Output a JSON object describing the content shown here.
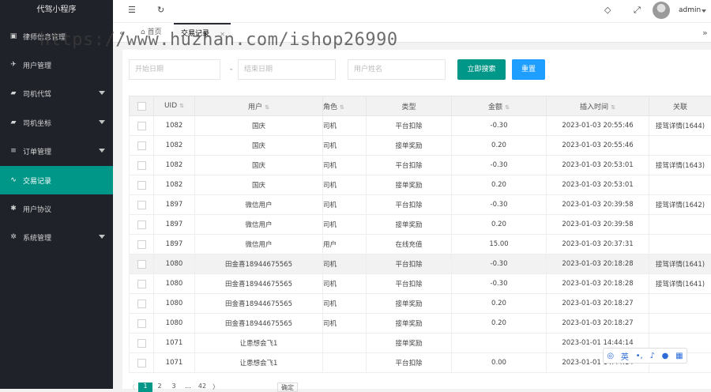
{
  "app": {
    "title": "代驾小程序"
  },
  "sidebar": {
    "items": [
      {
        "label": "律师信息管理",
        "icon": "file-icon",
        "has_arrow": false
      },
      {
        "label": "用户管理",
        "icon": "user-run-icon",
        "has_arrow": false
      },
      {
        "label": "司机代驾",
        "icon": "car-icon",
        "has_arrow": true
      },
      {
        "label": "司机坐标",
        "icon": "car-pin-icon",
        "has_arrow": true
      },
      {
        "label": "订单管理",
        "icon": "list-icon",
        "has_arrow": true
      },
      {
        "label": "交易记录",
        "icon": "trend-icon",
        "has_arrow": false,
        "active": true
      },
      {
        "label": "用户协议",
        "icon": "gear-small-icon",
        "has_arrow": false
      },
      {
        "label": "系统管理",
        "icon": "gear-icon",
        "has_arrow": true
      }
    ]
  },
  "header": {
    "username": "admin"
  },
  "tabs": {
    "home": "首页",
    "current": "交易记录"
  },
  "watermark": "https://www.huzhan.com/ishop26990",
  "search": {
    "start_placeholder": "开始日期",
    "sep": "-",
    "end_placeholder": "结束日期",
    "name_placeholder": "用户姓名",
    "search_label": "立即搜索",
    "reset_label": "重置"
  },
  "colors": {
    "accent": "#009688",
    "blue": "#1e9fff",
    "sidebar": "#20222a"
  },
  "table": {
    "headers": [
      "UID",
      "用户",
      "角色",
      "类型",
      "金额",
      "插入时间",
      "关联"
    ],
    "rows": [
      [
        "1082",
        "国庆",
        "司机",
        "平台扣除",
        "-0.30",
        "2023-01-03 20:55:46",
        "接驾详情(1644)"
      ],
      [
        "1082",
        "国庆",
        "司机",
        "接单奖励",
        "0.20",
        "2023-01-03 20:55:46",
        ""
      ],
      [
        "1082",
        "国庆",
        "司机",
        "平台扣除",
        "-0.30",
        "2023-01-03 20:53:01",
        "接驾详情(1643)"
      ],
      [
        "1082",
        "国庆",
        "司机",
        "接单奖励",
        "0.20",
        "2023-01-03 20:53:01",
        ""
      ],
      [
        "1897",
        "微信用户",
        "司机",
        "平台扣除",
        "-0.30",
        "2023-01-03 20:39:58",
        "接驾详情(1642)"
      ],
      [
        "1897",
        "微信用户",
        "司机",
        "接单奖励",
        "0.20",
        "2023-01-03 20:39:58",
        ""
      ],
      [
        "1897",
        "微信用户",
        "用户",
        "在线充值",
        "15.00",
        "2023-01-03 20:37:31",
        ""
      ],
      [
        "1080",
        "田金喜18944675565",
        "司机",
        "平台扣除",
        "-0.30",
        "2023-01-03 20:18:28",
        "接驾详情(1641)"
      ],
      [
        "1080",
        "田金喜18944675565",
        "司机",
        "平台扣除",
        "-0.30",
        "2023-01-03 20:18:28",
        "接驾详情(1641)"
      ],
      [
        "1080",
        "田金喜18944675565",
        "司机",
        "接单奖励",
        "0.20",
        "2023-01-03 20:18:27",
        ""
      ],
      [
        "1080",
        "田金喜18944675565",
        "司机",
        "接单奖励",
        "0.20",
        "2023-01-03 20:18:27",
        ""
      ],
      [
        "1071",
        "让患想会飞1",
        "",
        "接单奖励",
        "",
        "2023-01-01 14:44:14",
        ""
      ],
      [
        "1071",
        "让患想会飞1",
        "",
        "平台扣除",
        "0.00",
        "2023-01-01 14:44:14",
        ""
      ]
    ]
  },
  "ime": {
    "lang": "英"
  },
  "pager": {
    "current": "1",
    "p2": "2",
    "p3": "3",
    "ellipsis": "...",
    "last": "42",
    "next": "〉",
    "go_label": "确定"
  }
}
